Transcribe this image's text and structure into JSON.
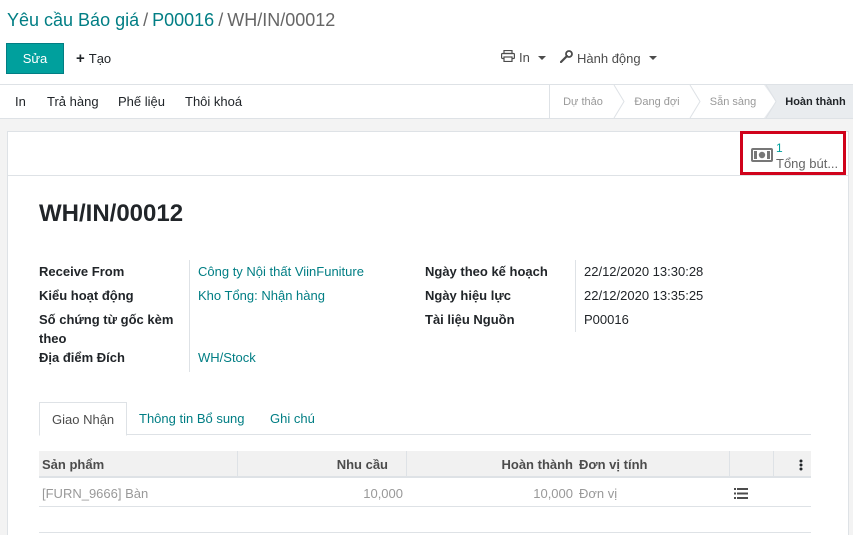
{
  "breadcrumb": {
    "level1": "Yêu cầu Báo giá",
    "level2": "P00016",
    "current": "WH/IN/00012",
    "separator": "/"
  },
  "toolbar": {
    "edit_label": "Sửa",
    "create_label": "Tạo",
    "print_label": "In",
    "action_label": "Hành động",
    "icons": {
      "create": "plus-icon",
      "print": "print-icon",
      "action": "wrench-icon"
    }
  },
  "statusbar": {
    "buttons": [
      "In",
      "Trả hàng",
      "Phế liệu",
      "Thôi khoá"
    ],
    "stages": [
      "Dự thảo",
      "Đang đợi",
      "Sẵn sàng",
      "Hoàn thành"
    ],
    "active_stage": "Hoàn thành"
  },
  "smart_button": {
    "count": "1",
    "label": "Tổng bút...",
    "icon": "money-icon",
    "highlight_color": "#d0021b"
  },
  "record": {
    "title": "WH/IN/00012",
    "left_fields": [
      {
        "label": "Receive From",
        "value": "Công ty Nội thất ViinFuniture"
      },
      {
        "label": "Kiểu hoạt động",
        "value": "Kho Tổng: Nhận hàng"
      },
      {
        "label": "Số chứng từ gốc kèm theo",
        "value": ""
      },
      {
        "label": "Địa điểm Đích",
        "value": "WH/Stock"
      }
    ],
    "right_fields": [
      {
        "label": "Ngày theo kế hoạch",
        "value": "22/12/2020 13:30:28"
      },
      {
        "label": "Ngày hiệu lực",
        "value": "22/12/2020 13:35:25"
      },
      {
        "label": "Tài liệu Nguồn",
        "value": "P00016"
      }
    ]
  },
  "tabs": [
    "Giao Nhận",
    "Thông tin Bổ sung",
    "Ghi chú"
  ],
  "table": {
    "columns": [
      "Sản phẩm",
      "Nhu cầu",
      "Hoàn thành",
      "Đơn vị tính"
    ],
    "rows": [
      {
        "product": "[FURN_9666] Bàn",
        "demand": "10,000",
        "done": "10,000",
        "uom": "Đơn vị"
      }
    ]
  },
  "colors": {
    "primary": "#00a09d",
    "link": "#017e84",
    "highlight": "#d0021b"
  }
}
